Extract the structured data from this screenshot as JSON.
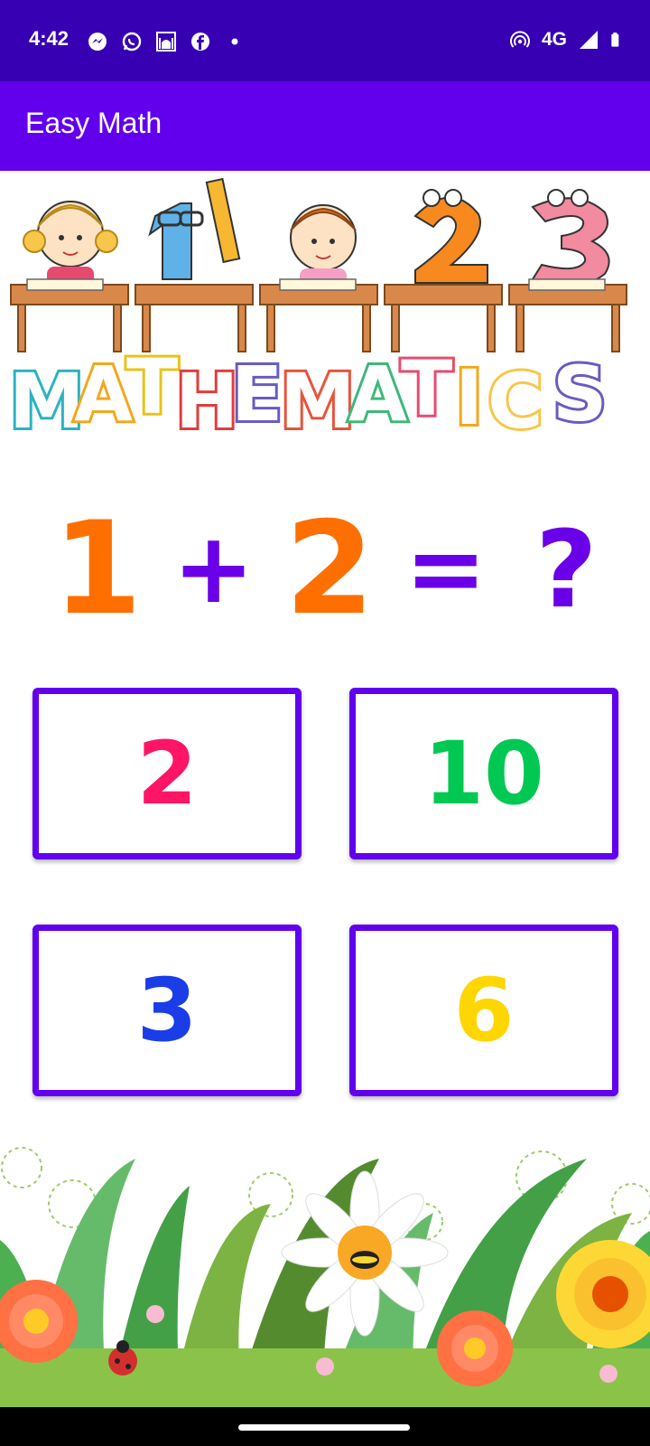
{
  "status_bar": {
    "time": "4:42",
    "network": "4G",
    "left_icons": [
      "messenger-icon",
      "whatsapp-icon",
      "mosque-icon",
      "facebook-icon",
      "dot-icon"
    ],
    "right_icons": [
      "hotspot-icon",
      "signal-icon",
      "battery-icon"
    ]
  },
  "app_bar": {
    "title": "Easy Math"
  },
  "banner": {
    "word": "MATHEMATICS"
  },
  "question": {
    "a": "1",
    "op": "+",
    "b": "2",
    "eq": "=",
    "unknown": "?"
  },
  "answers": [
    {
      "value": "2",
      "color": "#ff1565"
    },
    {
      "value": "10",
      "color": "#00c853"
    },
    {
      "value": "3",
      "color": "#1a3de8"
    },
    {
      "value": "6",
      "color": "#ffd600"
    }
  ],
  "colors": {
    "status_bar": "#3700b3",
    "app_bar": "#6200ee",
    "accent": "#6200ee",
    "equation_number": "#ff6f00",
    "equation_operator": "#6a00e8"
  }
}
